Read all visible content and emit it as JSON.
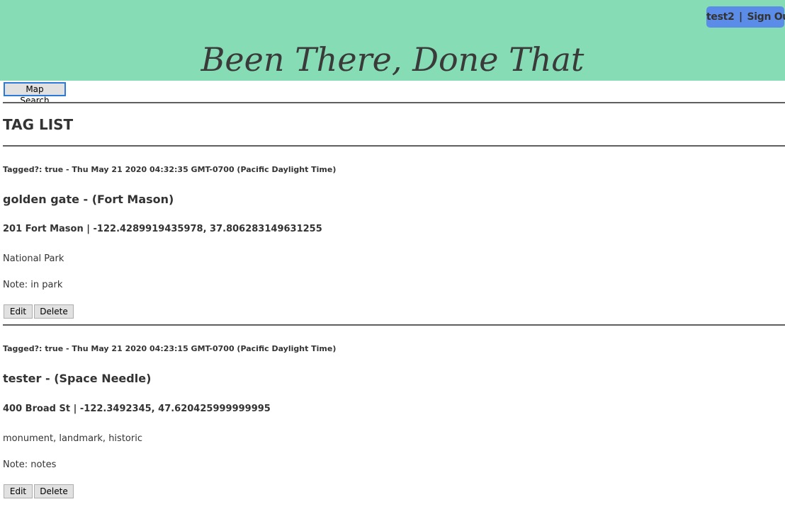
{
  "header": {
    "user": "test2",
    "separator": "|",
    "sign_out": "Sign Out",
    "title": "Been There, Done That",
    "background": "#85dcb5",
    "badge_color": "#5b8de8"
  },
  "toolbar": {
    "map_search_label": "Map Search"
  },
  "main": {
    "section_title": "TAG LIST",
    "tags": [
      {
        "tagged_line": "Tagged?: true - Thu May 21 2020 04:32:35 GMT-0700 (Pacific Daylight Time)",
        "name_line": "golden gate - (Fort Mason)",
        "address_line": "201 Fort Mason | -122.4289919435978, 37.806283149631255",
        "categories": "National Park",
        "note": "Note: in park",
        "edit_label": "Edit",
        "delete_label": "Delete"
      },
      {
        "tagged_line": "Tagged?: true - Thu May 21 2020 04:23:15 GMT-0700 (Pacific Daylight Time)",
        "name_line": "tester - (Space Needle)",
        "address_line": "400 Broad St | -122.3492345, 47.620425999999995",
        "categories": "monument, landmark, historic",
        "note": "Note: notes",
        "edit_label": "Edit",
        "delete_label": "Delete"
      }
    ]
  }
}
